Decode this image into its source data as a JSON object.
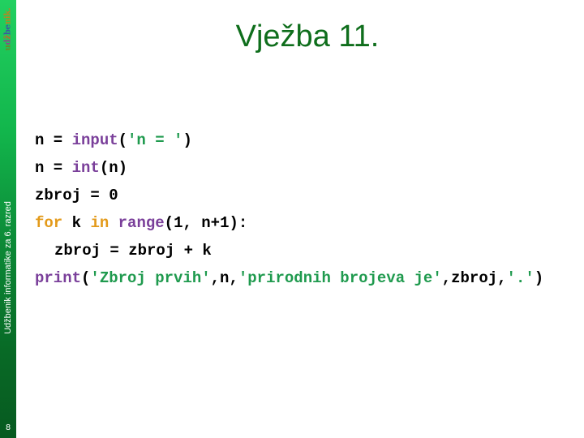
{
  "sidebar": {
    "logo_parts": [
      "u",
      "d",
      "ž",
      "be",
      "nik."
    ],
    "vertical_text": "Udžbenik informatike za 6. razred",
    "page_number": "8"
  },
  "slide": {
    "title": "Vježba 11."
  },
  "code": {
    "line1": {
      "a": "n = ",
      "fn": "input",
      "b": "(",
      "str": "'n = '",
      "c": ")"
    },
    "line2": {
      "a": "n = ",
      "fn": "int",
      "b": "(n)"
    },
    "line3": {
      "a": "zbroj = 0"
    },
    "line4": {
      "kw1": "for",
      "a": " k ",
      "kw2": "in",
      "b": " ",
      "fn": "range",
      "c": "(1, n+1):"
    },
    "line5": {
      "a": "zbroj = zbroj + k"
    },
    "line6": {
      "fn": "print",
      "a": "(",
      "s1": "'Zbroj prvih'",
      "b": ",n,",
      "s2": "'prirodnih brojeva je'",
      "c": ",zbroj,",
      "s3": "'.'",
      "d": ")"
    }
  },
  "colors": {
    "title": "#0f6e1c",
    "keyword": "#e39a1a",
    "builtin": "#7a3f9a",
    "string": "#1f9a4e",
    "sidebar_top": "#22d060",
    "sidebar_bottom": "#075a20"
  }
}
